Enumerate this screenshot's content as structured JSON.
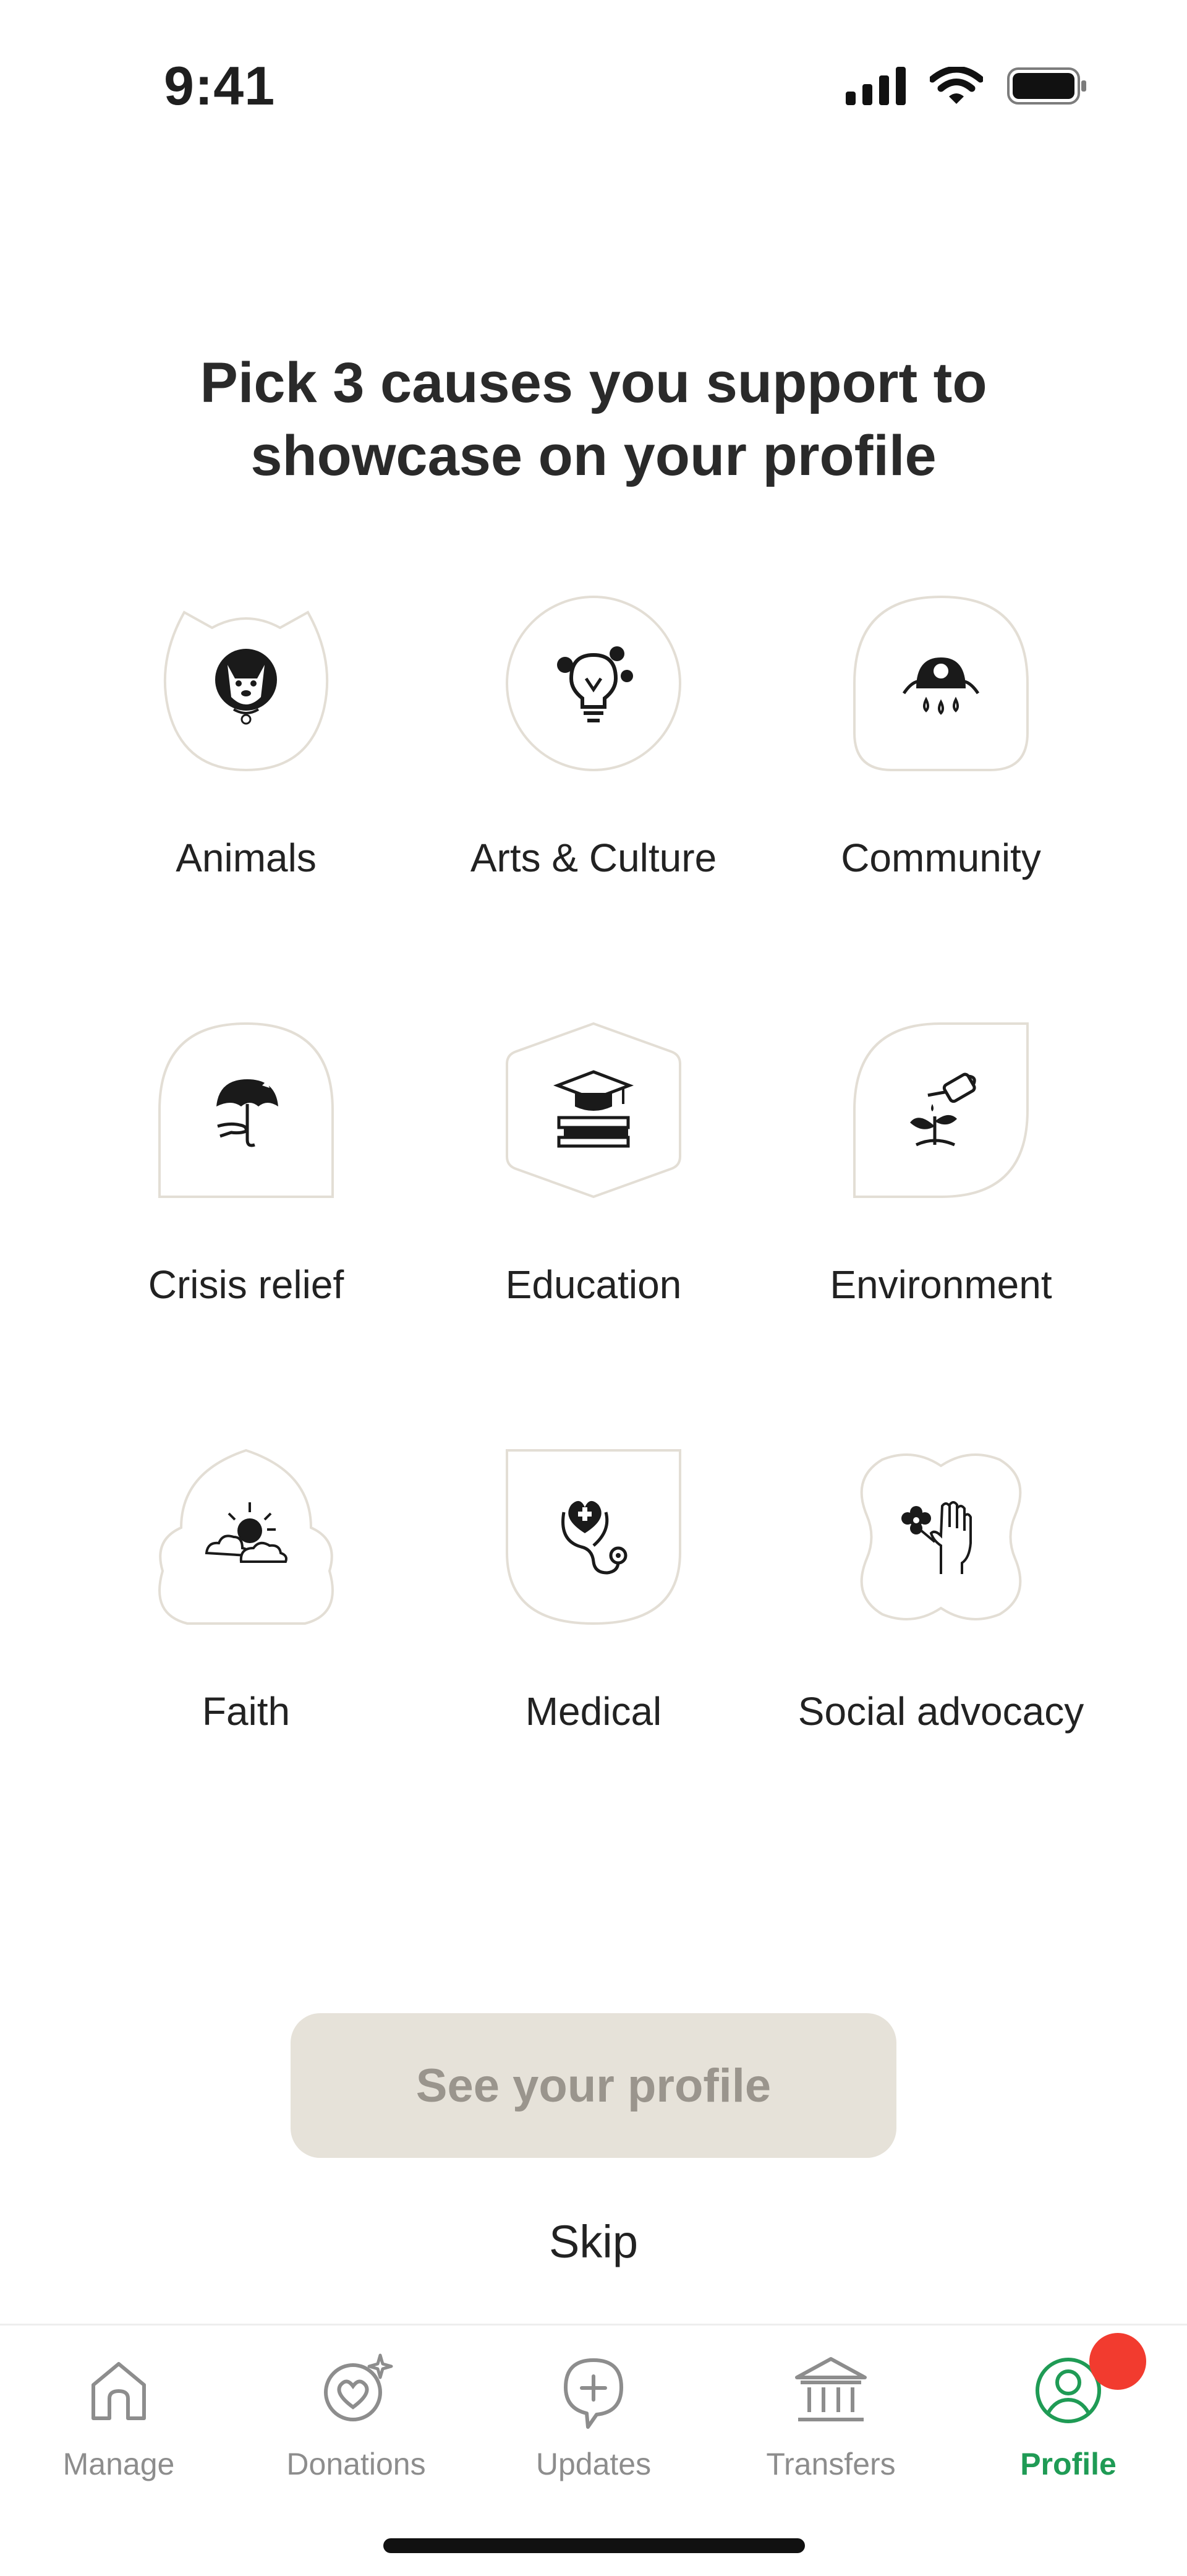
{
  "status_bar": {
    "time": "9:41"
  },
  "heading": {
    "line1": "Pick 3 causes you support to",
    "line2": "showcase on your profile"
  },
  "causes": [
    {
      "label": "Animals",
      "icon": "dog-icon"
    },
    {
      "label": "Arts & Culture",
      "icon": "lightbulb-icon"
    },
    {
      "label": "Community",
      "icon": "umbrella-raindrops-icon"
    },
    {
      "label": "Crisis relief",
      "icon": "umbrella-hand-icon"
    },
    {
      "label": "Education",
      "icon": "graduation-books-icon"
    },
    {
      "label": "Environment",
      "icon": "watering-can-plant-icon"
    },
    {
      "label": "Faith",
      "icon": "sun-clouds-icon"
    },
    {
      "label": "Medical",
      "icon": "stethoscope-heart-icon"
    },
    {
      "label": "Social advocacy",
      "icon": "hand-flower-icon"
    }
  ],
  "primary_button": {
    "label": "See your profile"
  },
  "skip": {
    "label": "Skip"
  },
  "tabs": [
    {
      "label": "Manage",
      "icon": "home-icon"
    },
    {
      "label": "Donations",
      "icon": "heart-sparkle-icon"
    },
    {
      "label": "Updates",
      "icon": "plus-bubble-icon"
    },
    {
      "label": "Transfers",
      "icon": "bank-icon"
    },
    {
      "label": "Profile",
      "icon": "profile-icon",
      "active": true
    }
  ],
  "colors": {
    "accent": "#1f9b55",
    "badge": "#f23b2f",
    "button_bg": "#e6e2d9",
    "button_text": "#9a958d",
    "tile_border": "#e3ded5"
  }
}
